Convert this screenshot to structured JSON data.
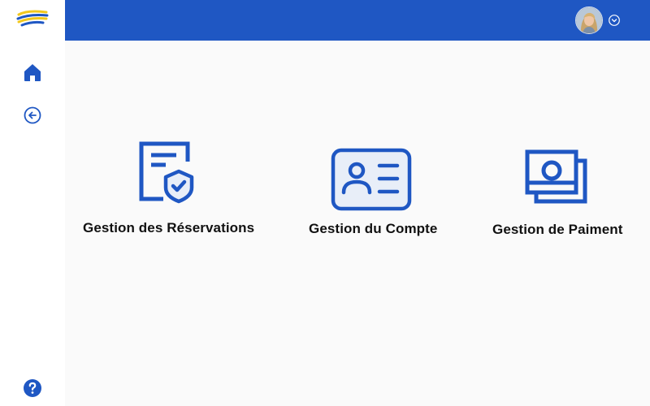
{
  "colors": {
    "primary": "#1f57c3",
    "background": "#fafafa",
    "sidebar": "#ffffff",
    "text": "#111111"
  },
  "sidebar": {
    "logo_icon": "striped-globe-logo",
    "items": [
      {
        "icon": "home-icon"
      },
      {
        "icon": "back-arrow-icon"
      },
      {
        "icon": "help-icon"
      }
    ]
  },
  "header": {
    "avatar_icon": "user-avatar",
    "menu_icon": "chevron-down-icon"
  },
  "main": {
    "cards": [
      {
        "label": "Gestion des Réservations",
        "icon": "document-shield-icon"
      },
      {
        "label": "Gestion du Compte",
        "icon": "id-card-icon"
      },
      {
        "label": "Gestion de Paiment",
        "icon": "money-bill-icon"
      }
    ]
  }
}
